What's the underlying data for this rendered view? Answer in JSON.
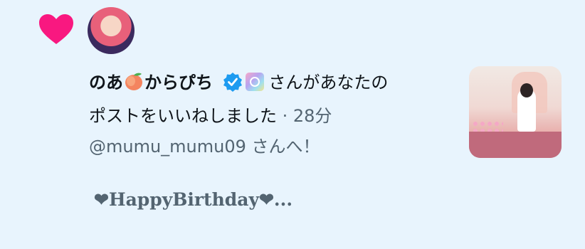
{
  "notification": {
    "icon": "heart-icon",
    "heart_color": "#f91880",
    "user_name_part1": "のあ",
    "user_name_emoji": "🍑",
    "user_name_part2": "からぴち",
    "action_text": "さんがあなたの",
    "action_text_2": "ポストをいいねしました",
    "time_separator": " · ",
    "time": "28分",
    "target_line": "@mumu_mumu09 さんへ！",
    "preview_text": "❤HappyBirthday❤..."
  },
  "colors": {
    "background": "#e8f4fd",
    "text": "#0f1419",
    "secondary_text": "#536471",
    "verified": "#1d9bf0"
  }
}
